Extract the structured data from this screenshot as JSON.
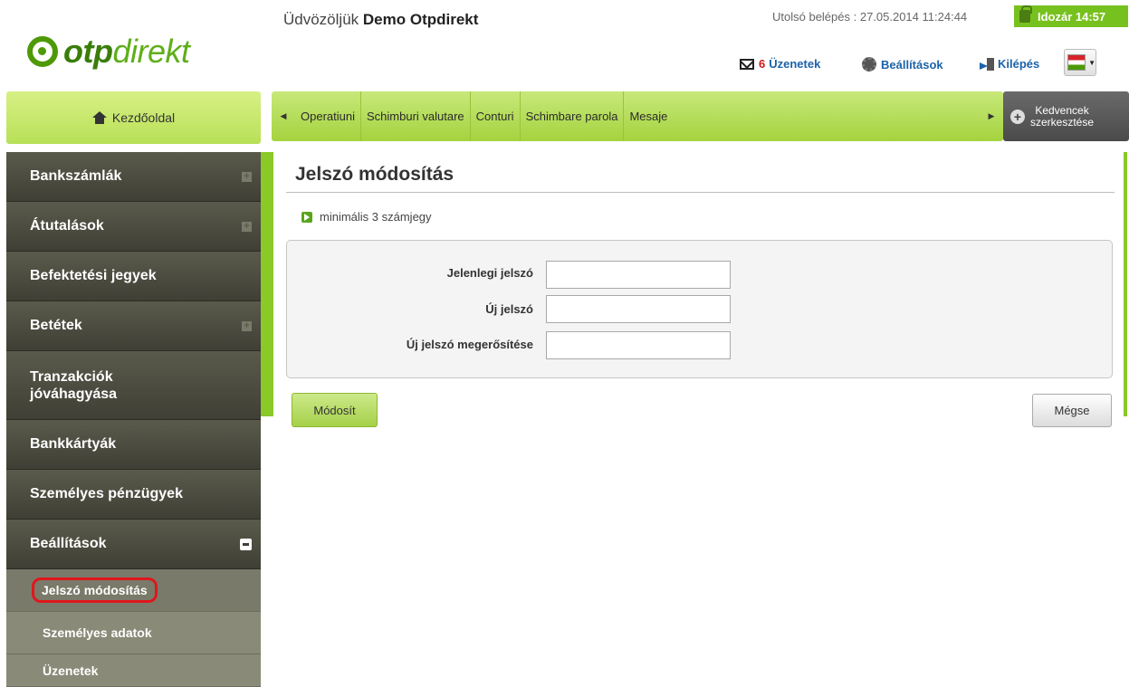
{
  "brand": {
    "logo_bold": "otp",
    "logo_light": "direkt"
  },
  "header": {
    "welcome_prefix": "Üdvözöljük",
    "welcome_name": "Demo Otpdirekt",
    "last_login": "Utolsó belépés : 27.05.2014 11:24:44",
    "timer": "Idozár 14:57",
    "messages_count": "6",
    "messages_label": "Üzenetek",
    "settings_label": "Beállítások",
    "logout_label": "Kilépés"
  },
  "home": {
    "label": "Kezdőoldal"
  },
  "topmenu": {
    "items": [
      "Operatiuni",
      "Schimburi valutare",
      "Conturi",
      "Schimbare parola",
      "Mesaje"
    ],
    "favorites_label_1": "Kedvencek",
    "favorites_label_2": "szerkesztése"
  },
  "sidebar": {
    "items": [
      {
        "label": "Bankszámlák"
      },
      {
        "label": "Átutalások"
      },
      {
        "label": "Befektetési jegyek"
      },
      {
        "label": "Betétek"
      },
      {
        "label_1": "Tranzakciók",
        "label_2": "jóváhagyása"
      },
      {
        "label": "Bankkártyák"
      },
      {
        "label": "Személyes pénzügyek"
      },
      {
        "label": "Beállítások"
      }
    ],
    "subitems": [
      {
        "label": "Jelszó módosítás"
      },
      {
        "label": "Személyes adatok"
      },
      {
        "label": "Üzenetek"
      }
    ]
  },
  "content": {
    "title": "Jelszó módosítás",
    "hint": "minimális 3 számjegy",
    "form": {
      "current_label": "Jelenlegi jelszó",
      "current_value": "",
      "new_label": "Új jelszó",
      "new_value": "",
      "confirm_label": "Új jelszó megerősítése",
      "confirm_value": ""
    },
    "submit_label": "Módosít",
    "cancel_label": "Mégse"
  },
  "colors": {
    "accent_green": "#a4d33e",
    "sidebar_dark": "#4a4a3e",
    "link_blue": "#1c62a8",
    "alert_red": "#d2161c"
  }
}
